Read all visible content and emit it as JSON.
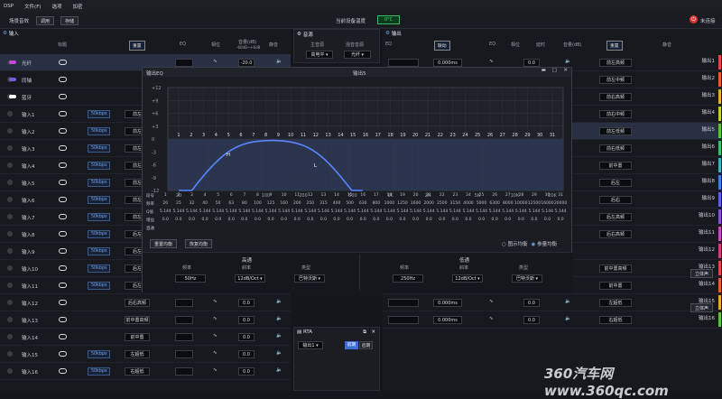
{
  "menu": {
    "app": "DSP",
    "file": "文件(F)",
    "options": "选项",
    "load": "加密"
  },
  "toolbar": {
    "title": "场景音效",
    "apply": "调用",
    "save": "存储",
    "temp_label": "当前设备温度",
    "temp_value": "0°C",
    "connect": "未连接"
  },
  "input_panel": {
    "title": "输入",
    "cols": [
      "标题",
      "EQ",
      "相位",
      "音量(dB)",
      "静音"
    ],
    "vol_range": "-60dB~+6dB",
    "rows": [
      {
        "name": "光纤",
        "vol": "-20.0"
      },
      {
        "name": "同轴",
        "vol": ""
      },
      {
        "name": "蓝牙",
        "vol": ""
      },
      {
        "name": "输入1",
        "rate": "50kbps",
        "dest": "前左"
      },
      {
        "name": "输入2",
        "rate": "50kbps",
        "dest": "前左"
      },
      {
        "name": "输入3",
        "rate": "50kbps",
        "dest": "前左"
      },
      {
        "name": "输入4",
        "rate": "50kbps",
        "dest": "前左"
      },
      {
        "name": "输入5",
        "rate": "50kbps",
        "dest": "前左"
      },
      {
        "name": "输入6",
        "rate": "50kbps",
        "dest": "前左"
      },
      {
        "name": "输入7",
        "rate": "50kbps",
        "dest": "前左"
      },
      {
        "name": "输入8",
        "rate": "50kbps",
        "dest": "后左"
      },
      {
        "name": "输入9",
        "rate": "50kbps",
        "dest": "后左"
      },
      {
        "name": "输入10",
        "rate": "50kbps",
        "dest": "后左"
      },
      {
        "name": "输入11",
        "rate": "50kbps",
        "dest": "后左"
      },
      {
        "name": "输入12",
        "rate": "",
        "dest": "后右高频",
        "vol": "0.0"
      },
      {
        "name": "输入13",
        "rate": "",
        "dest": "前中置高频",
        "vol": "0.0"
      },
      {
        "name": "输入14",
        "rate": "",
        "dest": "前中置",
        "vol": "0.0"
      },
      {
        "name": "输入15",
        "rate": "50kbps",
        "dest": "左超低",
        "vol": "0.0"
      },
      {
        "name": "输入16",
        "rate": "50kbps",
        "dest": "右超低",
        "vol": "0.0"
      }
    ],
    "reset": "重置"
  },
  "source_panel": {
    "title": "音源",
    "main": "主音源",
    "mix": "混音音源",
    "main_val": "高电平",
    "mix_val": "光纤"
  },
  "output_panel": {
    "title": "输出",
    "cols": [
      "EQ",
      "相位",
      "延时",
      "音量(dB)",
      "静音"
    ],
    "link": "联动",
    "reset": "重置",
    "rows": [
      {
        "delay": "0.000ms",
        "vol": "0.0",
        "dest": "前左高频",
        "out": "输出1"
      },
      {
        "delay": "",
        "vol": "",
        "dest": "前左中频",
        "out": "输出2"
      },
      {
        "delay": "",
        "vol": "",
        "dest": "前右高频",
        "out": "输出3"
      },
      {
        "delay": "",
        "vol": "",
        "dest": "前右中频",
        "out": "输出4"
      },
      {
        "delay": "",
        "vol": "",
        "dest": "前左低频",
        "out": "输出5"
      },
      {
        "delay": "",
        "vol": "",
        "dest": "前右低频",
        "out": "输出6"
      },
      {
        "delay": "",
        "vol": "",
        "dest": "前中置",
        "out": "输出7"
      },
      {
        "delay": "",
        "vol": "",
        "dest": "后左",
        "out": "输出8"
      },
      {
        "delay": "",
        "vol": "",
        "dest": "后右",
        "out": "输出9"
      },
      {
        "delay": "",
        "vol": "",
        "dest": "后左高频",
        "out": "输出10"
      },
      {
        "delay": "",
        "vol": "",
        "dest": "后右高频",
        "out": "输出11"
      },
      {
        "delay": "",
        "vol": "",
        "dest": "",
        "out": "输出12"
      },
      {
        "delay": "0.000ms",
        "vol": "0.0",
        "dest": "前中置高频",
        "out": "输出13"
      },
      {
        "delay": "0.000ms",
        "vol": "0.0",
        "dest": "前中置",
        "out": "输出14"
      },
      {
        "delay": "0.000ms",
        "vol": "0.0",
        "dest": "左超低",
        "out": "输出15"
      },
      {
        "delay": "0.000ms",
        "vol": "0.0",
        "dest": "右超低",
        "out": "输出16"
      }
    ],
    "extra": "立体声"
  },
  "rta": {
    "title": "RTA",
    "select": "输出1",
    "btn1": "前期",
    "btn2": "后期"
  },
  "eq_window": {
    "title": "输出EQ",
    "channel": "输出5",
    "ylabels": [
      "+12",
      "+9",
      "+6",
      "+3",
      "0",
      "-3",
      "-6",
      "-9",
      "-12"
    ],
    "xlabels": [
      "20",
      "100",
      "200",
      "500",
      "1K",
      "2K",
      "5K",
      "10K",
      "20K"
    ],
    "band_numbers": [
      "1",
      "2",
      "3",
      "4",
      "5",
      "6",
      "7",
      "8",
      "9",
      "10",
      "11",
      "12",
      "13",
      "14",
      "15",
      "16",
      "17",
      "18",
      "19",
      "20",
      "21",
      "22",
      "23",
      "24",
      "25",
      "26",
      "27",
      "28",
      "29",
      "30",
      "31"
    ],
    "markers": {
      "high": "H",
      "low": "L"
    },
    "param_labels": [
      "段号",
      "频率",
      "Q值",
      "增益",
      "直通"
    ],
    "freqs": [
      "20",
      "25",
      "32",
      "40",
      "50",
      "63",
      "80",
      "100",
      "125",
      "160",
      "200",
      "250",
      "315",
      "400",
      "500",
      "630",
      "800",
      "1000",
      "1250",
      "1600",
      "2000",
      "2500",
      "3150",
      "4000",
      "5000",
      "6300",
      "8000",
      "10000",
      "12500",
      "16000",
      "20000"
    ],
    "q": "5.144",
    "gain": "0.0",
    "reset_eq": "重置均衡",
    "bypass": "恢复均衡",
    "opt_graphic": "图示均衡",
    "opt_param": "参量均衡",
    "hp": {
      "title": "高通",
      "freq_label": "频率",
      "slope_label": "斜率",
      "type_label": "类型",
      "freq": "50Hz",
      "slope": "12dB/Oct",
      "type": "巴特沃斯"
    },
    "lp": {
      "title": "低通",
      "freq_label": "频率",
      "slope_label": "斜率",
      "type_label": "类型",
      "freq": "250Hz",
      "slope": "12dB/Oct",
      "type": "巴特沃斯"
    }
  },
  "watermark": "360汽车网 www.360qc.com",
  "colors": {
    "accent": "#3b6fd6",
    "temp": "#39e46a",
    "curve": "#5a86ff"
  }
}
